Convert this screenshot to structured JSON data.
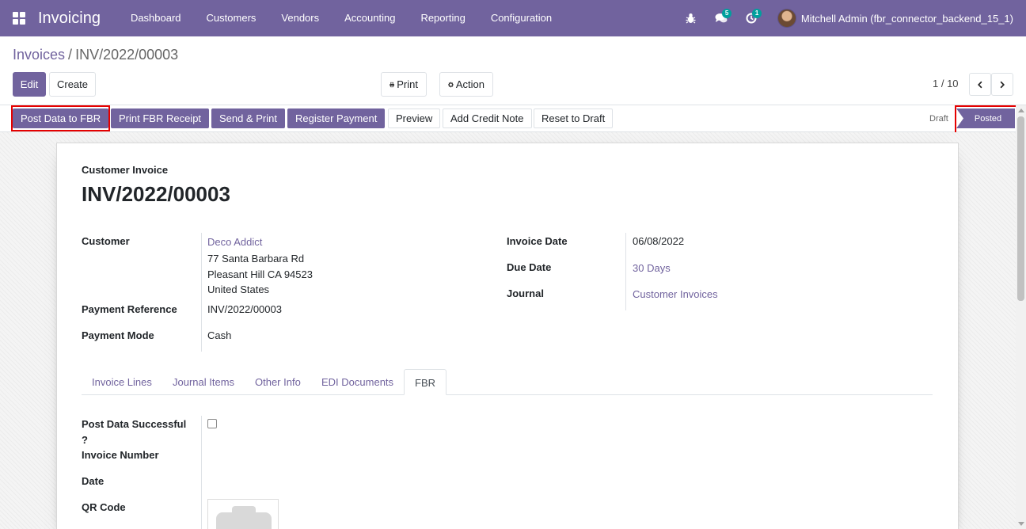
{
  "navbar": {
    "app_title": "Invoicing",
    "menu": [
      "Dashboard",
      "Customers",
      "Vendors",
      "Accounting",
      "Reporting",
      "Configuration"
    ],
    "messages_badge": "5",
    "activities_badge": "1",
    "user_name": "Mitchell Admin (fbr_connector_backend_15_1)",
    "accent_color": "#71639e"
  },
  "breadcrumb": {
    "parent": "Invoices",
    "separator": "/",
    "current": "INV/2022/00003"
  },
  "control": {
    "edit_label": "Edit",
    "create_label": "Create",
    "print_label": "Print",
    "action_label": "Action",
    "pager": "1 / 10"
  },
  "statusbar": {
    "buttons": [
      "Post Data to FBR",
      "Print FBR Receipt",
      "Send & Print",
      "Register Payment",
      "Preview",
      "Add Credit Note",
      "Reset to Draft"
    ],
    "stages": {
      "draft": "Draft",
      "posted": "Posted"
    },
    "active_stage": "Posted"
  },
  "invoice": {
    "type_label": "Customer Invoice",
    "number": "INV/2022/00003",
    "customer_label": "Customer",
    "customer_name": "Deco Addict",
    "customer_address": [
      "77 Santa Barbara Rd",
      "Pleasant Hill CA 94523",
      "United States"
    ],
    "payment_reference_label": "Payment Reference",
    "payment_reference": "INV/2022/00003",
    "payment_mode_label": "Payment Mode",
    "payment_mode": "Cash",
    "invoice_date_label": "Invoice Date",
    "invoice_date": "06/08/2022",
    "due_date_label": "Due Date",
    "due_date": "30 Days",
    "journal_label": "Journal",
    "journal": "Customer Invoices"
  },
  "tabs": [
    "Invoice Lines",
    "Journal Items",
    "Other Info",
    "EDI Documents",
    "FBR"
  ],
  "active_tab": "FBR",
  "fbr": {
    "post_success_label_1": "Post Data Successful",
    "post_success_label_2": "?",
    "post_success_checked": false,
    "invoice_number_label": "Invoice Number",
    "date_label": "Date",
    "qr_code_label": "QR Code"
  }
}
